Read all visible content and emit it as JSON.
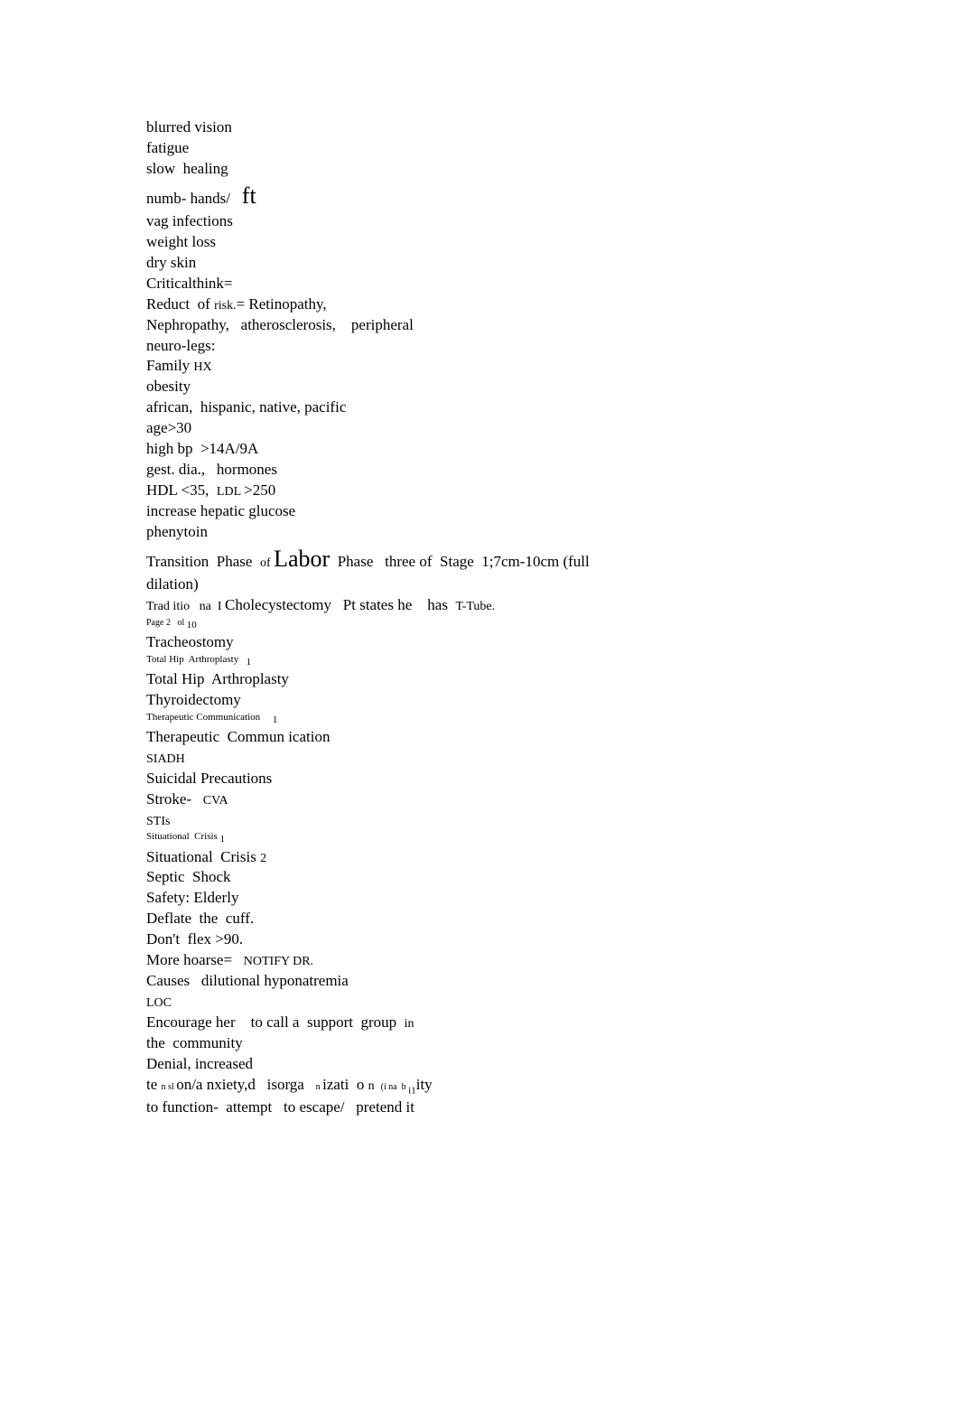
{
  "bullet_glyph": "",
  "lines": [
    {
      "segments": [
        {
          "t": "blurred vision"
        }
      ]
    },
    {
      "segments": [
        {
          "t": "fatigue"
        }
      ]
    },
    {
      "segments": [
        {
          "t": "slow  healing"
        }
      ]
    },
    {
      "segments": [
        {
          "t": "numb- hands/   "
        },
        {
          "t": "ft",
          "cls": "big"
        }
      ]
    },
    {
      "segments": [
        {
          "t": "vag "
        },
        {
          "t": "infections"
        }
      ]
    },
    {
      "segments": [
        {
          "t": "weight "
        },
        {
          "t": "loss"
        }
      ]
    },
    {
      "segments": [
        {
          "t": "dry skin"
        }
      ]
    },
    {
      "segments": [
        {
          "t": "Criticalthink="
        }
      ]
    },
    {
      "segments": [
        {
          "t": "Reduct  "
        },
        {
          "t": "of "
        },
        {
          "t": "risk.",
          "cls": "sm"
        },
        {
          "t": "= Retinopathy,"
        }
      ]
    },
    {
      "segments": [
        {
          "t": "Nephropathy,   atherosclerosis,    peripheral"
        }
      ]
    },
    {
      "segments": [
        {
          "t": "neuro-legs:"
        }
      ]
    },
    {
      "segments": [
        {
          "t": "Family "
        },
        {
          "t": "HX",
          "cls": "sm"
        }
      ]
    },
    {
      "segments": [
        {
          "t": "obesity"
        }
      ]
    },
    {
      "segments": [
        {
          "t": "african,  hispanic, native, pacific"
        }
      ]
    },
    {
      "segments": [
        {
          "t": "age>30"
        }
      ]
    },
    {
      "segments": [
        {
          "t": "high bp  >14A/9A"
        }
      ]
    },
    {
      "segments": [
        {
          "t": "gest. dia.,   hormones"
        }
      ]
    },
    {
      "segments": [
        {
          "t": "HDL <35,  "
        },
        {
          "t": "LDL ",
          "cls": "sm"
        },
        {
          "t": ">250"
        }
      ]
    },
    {
      "segments": [
        {
          "t": "increase hepatic glucose"
        }
      ]
    },
    {
      "segments": [
        {
          "t": "phenytoin"
        }
      ]
    },
    {
      "segments": [
        {
          "t": "Transition  Phase  "
        },
        {
          "t": "of ",
          "cls": "sm"
        },
        {
          "t": "Labor",
          "cls": "big"
        },
        {
          "t": "  Phase   three of  Stage  1;7cm-10cm (full"
        }
      ]
    },
    {
      "segments": [
        {
          "t": "dilation)"
        }
      ]
    },
    {
      "segments": [
        {
          "t": "Trad itio   na  I ",
          "cls": "sm"
        },
        {
          "t": "Cholecystectomy   "
        },
        {
          "t": "Pt "
        },
        {
          "t": "states he    has  "
        },
        {
          "t": "T-Tube.",
          "cls": "sm"
        }
      ]
    },
    {
      "tiny": true,
      "segments": [
        {
          "t": "Page 2   ol ",
          "cls": "xs"
        },
        {
          "t": "10",
          "cls": "sub"
        }
      ]
    },
    {
      "segments": [
        {
          "t": "Tracheostomy"
        }
      ]
    },
    {
      "tiny": true,
      "segments": [
        {
          "t": "Total Hip  Arthroplasty   "
        },
        {
          "t": "1",
          "cls": "sub"
        }
      ]
    },
    {
      "segments": [
        {
          "t": "Total Hip  Arthroplasty"
        }
      ]
    },
    {
      "segments": [
        {
          "t": "Thyroidectomy"
        }
      ]
    },
    {
      "tiny": true,
      "segments": [
        {
          "t": "Therapeutic Communication     "
        },
        {
          "t": "1",
          "cls": "sub"
        }
      ]
    },
    {
      "segments": [
        {
          "t": "Therapeutic  Commun ication"
        }
      ]
    },
    {
      "segments": [
        {
          "t": "SIADH",
          "cls": "sm"
        }
      ]
    },
    {
      "segments": [
        {
          "t": "Suicidal Precautions"
        }
      ]
    },
    {
      "segments": [
        {
          "t": "Stroke-   "
        },
        {
          "t": "CVA",
          "cls": "sm"
        }
      ]
    },
    {
      "segments": [
        {
          "t": "STIs",
          "cls": "sm"
        }
      ]
    },
    {
      "tiny": true,
      "segments": [
        {
          "t": "Situational  Crisis "
        },
        {
          "t": "1",
          "cls": "sub"
        }
      ]
    },
    {
      "segments": [
        {
          "t": "Situational  Crisis "
        },
        {
          "t": "2",
          "cls": "sm"
        }
      ]
    },
    {
      "segments": [
        {
          "t": "Septic  Shock"
        }
      ]
    },
    {
      "segments": [
        {
          "t": "Safety: Elderly"
        }
      ]
    },
    {
      "segments": [
        {
          "t": "Deflate  the  cuff."
        }
      ]
    },
    {
      "segments": [
        {
          "t": "Don't  flex >90."
        }
      ]
    },
    {
      "segments": [
        {
          "t": "More hoarse=   "
        },
        {
          "t": "NOTIFY DR.",
          "cls": "sm"
        }
      ]
    },
    {
      "segments": [
        {
          "t": "Causes   "
        },
        {
          "t": "dilutional "
        },
        {
          "t": "hyponatremia"
        }
      ]
    },
    {
      "segments": [
        {
          "t": "LOC",
          "cls": "sm"
        }
      ]
    },
    {
      "segments": [
        {
          "t": "Encourage her    "
        },
        {
          "t": "to "
        },
        {
          "t": "call "
        },
        {
          "t": "a  "
        },
        {
          "t": "support  group  "
        },
        {
          "t": "in",
          "cls": "sm"
        }
      ]
    },
    {
      "segments": [
        {
          "t": "the  community"
        }
      ]
    },
    {
      "segments": [
        {
          "t": "Denial, increased"
        }
      ]
    },
    {
      "segments": [
        {
          "t": "te "
        },
        {
          "t": "n sl ",
          "cls": "xs"
        },
        {
          "t": "on/a nxiety,d   isorga   "
        },
        {
          "t": "n ",
          "cls": "xs"
        },
        {
          "t": "izati  o "
        },
        {
          "t": "n  ",
          "cls": "sm"
        },
        {
          "t": "(i na  b ",
          "cls": "xs"
        },
        {
          "t": "i1",
          "cls": "sub"
        },
        {
          "t": "ity"
        }
      ]
    },
    {
      "segments": [
        {
          "t": "to function-  attempt   to "
        },
        {
          "t": "escape/   "
        },
        {
          "t": "pretend it"
        }
      ]
    }
  ]
}
